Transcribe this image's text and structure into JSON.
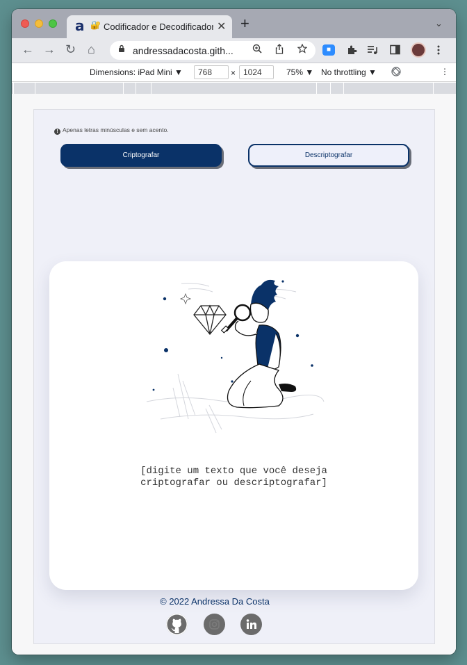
{
  "browser": {
    "tab": {
      "favicon": "a",
      "lock_emoji": "🔐",
      "title": "Codificador e Decodificador",
      "close": "✕"
    },
    "new_tab": "+",
    "tab_menu": "⌄",
    "nav": {
      "back": "←",
      "forward": "→",
      "reload": "↻",
      "home": "⌂"
    },
    "url": "andressadacosta.gith...",
    "extensions": {
      "zoom": "■"
    }
  },
  "devtools": {
    "dimensions_label": "Dimensions: iPad Mini ▼",
    "width": "768",
    "times": "×",
    "height": "1024",
    "zoom": "75% ▼",
    "throttling": "No throttling ▼",
    "more": "⋮"
  },
  "app": {
    "hint": "Apenas letras minúsculas e sem acento.",
    "hint_icon": "!",
    "encrypt_label": "Criptografar",
    "decrypt_label": "Descriptografar",
    "message_line1": "[digite um texto que você deseja",
    "message_line2": "criptografar ou descriptografar]",
    "footer": "© 2022 Andressa Da Costa",
    "social": [
      "github",
      "instagram",
      "linkedin"
    ]
  },
  "colors": {
    "primary": "#0a3268",
    "page_bg": "#eff0f8",
    "social_gray": "#6b6b6b"
  }
}
